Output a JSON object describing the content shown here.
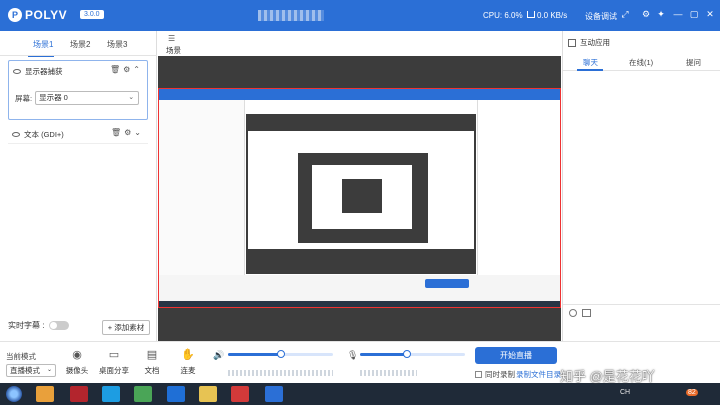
{
  "titlebar": {
    "brand": "POLYV",
    "version": "3.0.0",
    "cpu": "CPU: 6.0%",
    "net": "0.0 KB/s",
    "device_test": "设备调试"
  },
  "left": {
    "tabs": [
      "场景1",
      "场景2",
      "场景3"
    ],
    "sources": [
      {
        "label": "显示器捕获",
        "screen_label": "屏幕:",
        "screen_value": "显示器 0"
      },
      {
        "label": "文本 (GDI+)"
      }
    ],
    "realtime_subtitle": "实时字幕 :",
    "add_material": "+ 添加素材"
  },
  "center": {
    "scene_title": "场景"
  },
  "right": {
    "panel_title": "互动应用",
    "tabs": [
      "聊天",
      "在线(1)",
      "提问"
    ]
  },
  "bottom": {
    "mode_label": "当前模式",
    "mode_value": "直播模式",
    "controls": [
      "摄像头",
      "桌面分享",
      "文档",
      "连麦"
    ],
    "start_live": "开始直播",
    "sync_record": "同时录制",
    "record_file": "录制文件目录",
    "speaker_level": 0.5,
    "mic_level": 0.45
  },
  "taskbar": {
    "tray_text": "CH",
    "badge": "82"
  },
  "watermark": "知乎 @是花花吖"
}
